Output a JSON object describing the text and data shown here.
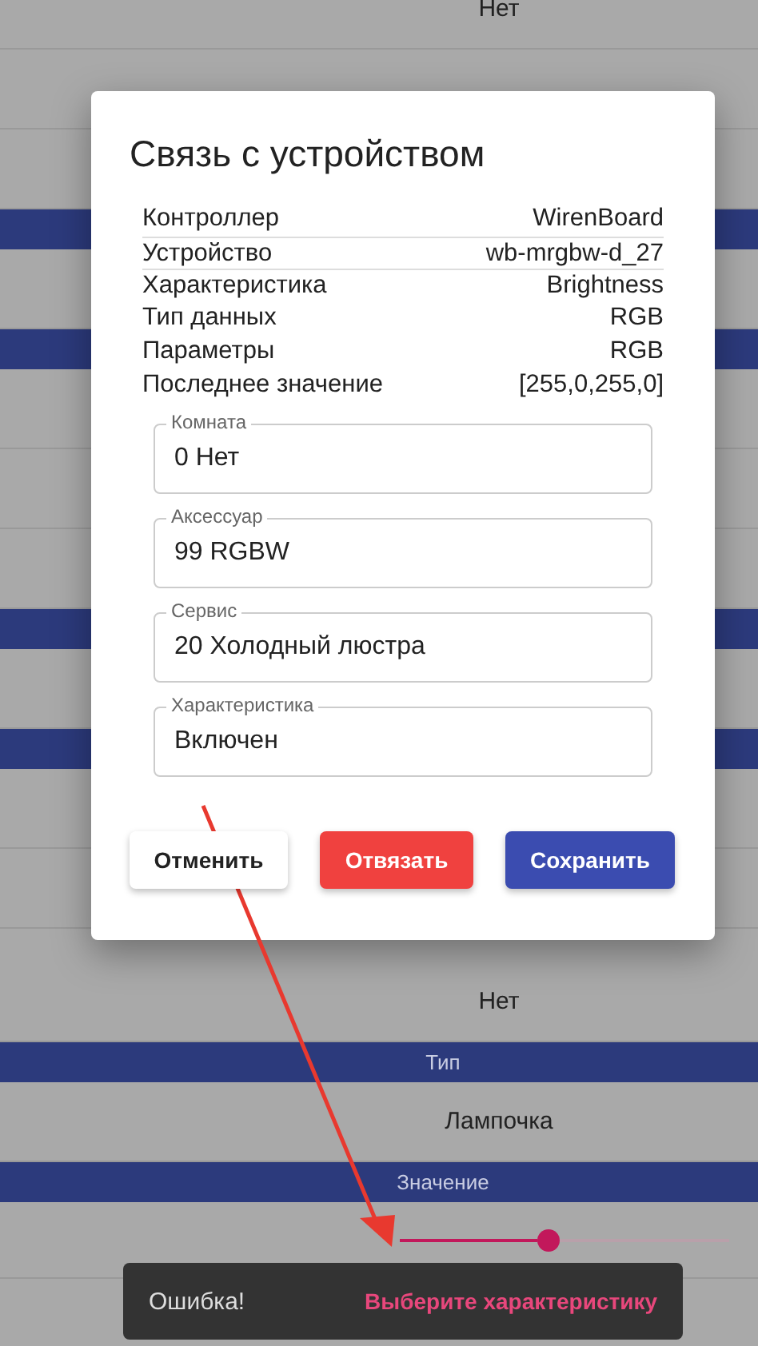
{
  "background_list": {
    "top_rows": [
      {
        "kind": "value",
        "label": "Нет"
      },
      {
        "kind": "value"
      },
      {
        "kind": "value"
      },
      {
        "kind": "header"
      },
      {
        "kind": "value"
      },
      {
        "kind": "header"
      },
      {
        "kind": "value"
      },
      {
        "kind": "value"
      },
      {
        "kind": "value"
      },
      {
        "kind": "header"
      },
      {
        "kind": "value"
      },
      {
        "kind": "header"
      },
      {
        "kind": "value"
      },
      {
        "kind": "value"
      }
    ],
    "bottom_rows": [
      {
        "kind": "value",
        "label": "Нет"
      },
      {
        "kind": "header",
        "label": "Тип"
      },
      {
        "kind": "value",
        "label": "Лампочка"
      },
      {
        "kind": "header",
        "label": "Значение"
      },
      {
        "kind": "slider",
        "level": 0.45
      },
      {
        "kind": "value"
      }
    ]
  },
  "dialog": {
    "title": "Связь с устройством",
    "info": [
      {
        "label": "Контроллер",
        "value": "WirenBoard",
        "divider": false
      },
      {
        "label": "Устройство",
        "value": "wb-mrgbw-d_27",
        "divider": true
      },
      {
        "label": "Характеристика",
        "value": "Brightness",
        "divider": true
      },
      {
        "label": "Тип данных",
        "value": "RGB",
        "divider": false
      },
      {
        "label": "Параметры",
        "value": "RGB",
        "divider": false
      },
      {
        "label": "Последнее значение",
        "value": "[255,0,255,0]",
        "divider": false
      }
    ],
    "fields": [
      {
        "label": "Комната",
        "value": "0 Нет"
      },
      {
        "label": "Аксессуар",
        "value": "99 RGBW"
      },
      {
        "label": "Сервис",
        "value": "20 Холодный люстра"
      },
      {
        "label": "Характеристика",
        "value": "Включен"
      }
    ],
    "buttons": [
      {
        "kind": "cancel",
        "label": "Отменить"
      },
      {
        "kind": "danger",
        "label": "Отвязать"
      },
      {
        "kind": "primary",
        "label": "Сохранить"
      }
    ]
  },
  "snackbar": {
    "message": "Ошибка!",
    "action": "Выберите характеристику"
  }
}
